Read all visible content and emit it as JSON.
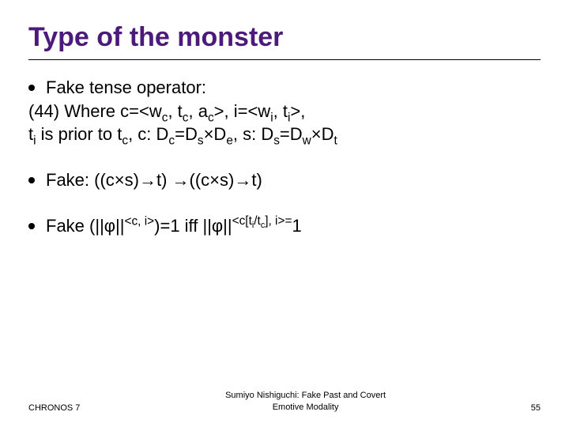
{
  "title": "Type of the monster",
  "bullet1_lead": "Fake tense operator:",
  "line2_a": "(44) Where c=<w",
  "line2_b": ", t",
  "line2_c": ", a",
  "line2_d": ">, i=<w",
  "line2_e": ", t",
  "line2_f": ">,",
  "line3_a": "t",
  "line3_b": " is prior to t",
  "line3_c": ", c: D",
  "line3_d": "=D",
  "line3_e": "×D",
  "line3_f": ", s: D",
  "line3_g": "=D",
  "line3_h": "×D",
  "sub_c": "c",
  "sub_i": "i",
  "sub_s": "s",
  "sub_e": "e",
  "sub_w": "w",
  "sub_t": "t",
  "bullet2": "Fake: ((c×s)→t) →((c×s)→t)",
  "b3_a": "Fake (||φ||",
  "b3_sup1": "<c, i>",
  "b3_b": ")=1 iff ||φ||",
  "b3_sup2a": "<c[t",
  "b3_sup2_sub1": "i",
  "b3_sup2b": "/t",
  "b3_sup2_sub2": "c",
  "b3_sup2c": "], i>=",
  "b3_c": "1",
  "footer_left": "CHRONOS 7",
  "footer_center_l1": "Sumiyo Nishiguchi: Fake Past and Covert",
  "footer_center_l2": "Emotive Modality",
  "footer_right": "55"
}
